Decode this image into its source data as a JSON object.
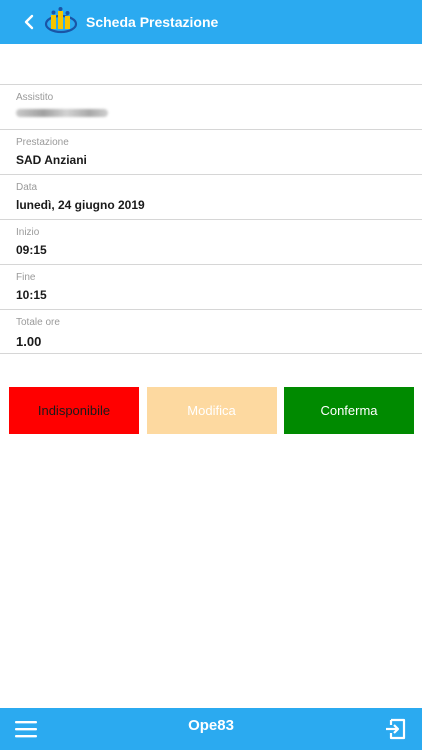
{
  "header": {
    "title": "Scheda Prestazione",
    "background": "#2baaf0",
    "back_icon": "chevron-left-icon",
    "logo_icon": "app-logo-icon"
  },
  "form": {
    "fields": [
      {
        "label": "Assistito",
        "value": ""
      },
      {
        "label": "Prestazione",
        "value": "SAD Anziani"
      },
      {
        "label": "Data",
        "value": "lunedì, 24 giugno 2019"
      },
      {
        "label": "Inizio",
        "value": "09:15"
      },
      {
        "label": "Fine",
        "value": "10:15"
      },
      {
        "label": "Totale ore",
        "value": "1.00"
      }
    ]
  },
  "actions": {
    "unavailable_label": "Indisponibile",
    "unavailable_color": "#ff0000",
    "edit_label": "Modifica",
    "edit_color": "#fdd9a0",
    "confirm_label": "Conferma",
    "confirm_color": "#008a00"
  },
  "footer": {
    "title": "Ope83",
    "menu_icon": "hamburger-menu-icon",
    "exit_icon": "logout-icon"
  }
}
